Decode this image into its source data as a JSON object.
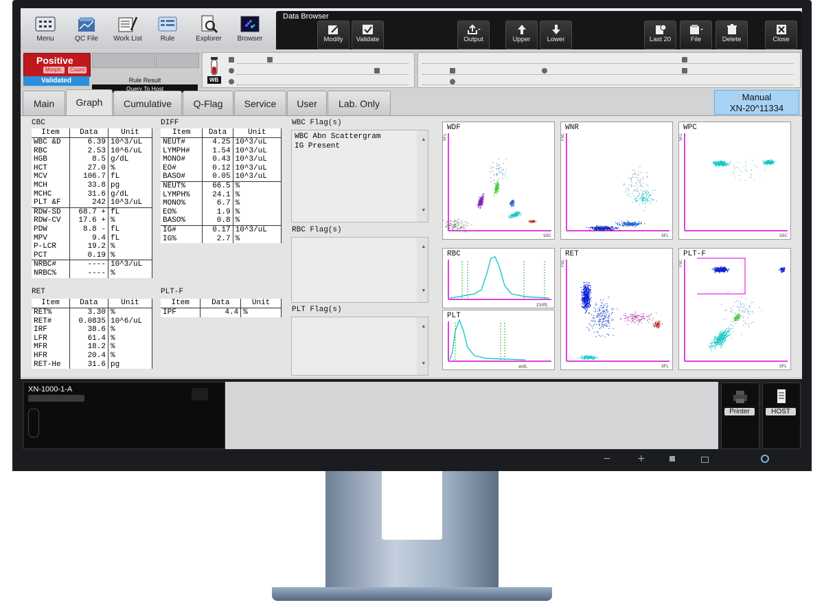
{
  "toolbar": {
    "left_buttons": [
      "Menu",
      "QC File",
      "Work List",
      "Rule",
      "Explorer",
      "Browser"
    ],
    "data_browser_title": "Data Browser",
    "db_buttons": [
      "Modify",
      "Validate",
      "Output",
      "Upper",
      "Lower",
      "Last 20",
      "File",
      "Delete",
      "Close"
    ]
  },
  "status": {
    "result": "Positive",
    "morph": "Morph.",
    "count": "Count",
    "validated": "Validated",
    "rule_result": "Rule Result",
    "query_to_host": "Query To Host",
    "tube_label": "WB"
  },
  "tabs": [
    "Main",
    "Graph",
    "Cumulative",
    "Q-Flag",
    "Service",
    "User",
    "Lab. Only"
  ],
  "active_tab": "Graph",
  "manual": {
    "line1": "Manual",
    "line2": "XN-20^11334"
  },
  "cbc": {
    "title": "CBC",
    "headers": [
      "Item",
      "Data",
      "Unit"
    ],
    "rows": [
      [
        "WBC &D",
        "6.39",
        "10^3/uL"
      ],
      [
        "RBC",
        "2.53",
        "10^6/uL"
      ],
      [
        "HGB",
        "8.5",
        "g/dL"
      ],
      [
        "HCT",
        "27.0",
        "%"
      ],
      [
        "MCV",
        "106.7",
        "fL"
      ],
      [
        "MCH",
        "33.8",
        "pg"
      ],
      [
        "MCHC",
        "31.6",
        "g/dL"
      ],
      [
        "PLT &F",
        "242",
        "10^3/uL"
      ],
      [
        "RDW-SD",
        "68.7 +",
        "fL"
      ],
      [
        "RDW-CV",
        "17.6 +",
        "%"
      ],
      [
        "PDW",
        "8.8 -",
        "fL"
      ],
      [
        "MPV",
        "9.4",
        "fL"
      ],
      [
        "P-LCR",
        "19.2",
        "%"
      ],
      [
        "PCT",
        "0.19",
        "%"
      ],
      [
        "NRBC#",
        "----",
        "10^3/uL"
      ],
      [
        "NRBC%",
        "----",
        "%"
      ]
    ]
  },
  "ret": {
    "title": "RET",
    "headers": [
      "Item",
      "Data",
      "Unit"
    ],
    "rows": [
      [
        "RET%",
        "3.30",
        "%"
      ],
      [
        "RET#",
        "0.0835",
        "10^6/uL"
      ],
      [
        "IRF",
        "38.6",
        "%"
      ],
      [
        "LFR",
        "61.4",
        "%"
      ],
      [
        "MFR",
        "18.2",
        "%"
      ],
      [
        "HFR",
        "20.4",
        "%"
      ],
      [
        "RET-He",
        "31.6",
        "pg"
      ]
    ]
  },
  "diff": {
    "title": "DIFF",
    "headers": [
      "Item",
      "Data",
      "Unit"
    ],
    "rows": [
      [
        "NEUT#",
        "4.25",
        "10^3/uL"
      ],
      [
        "LYMPH#",
        "1.54",
        "10^3/uL"
      ],
      [
        "MONO#",
        "0.43",
        "10^3/uL"
      ],
      [
        "EO#",
        "0.12",
        "10^3/uL"
      ],
      [
        "BASO#",
        "0.05",
        "10^3/uL"
      ],
      [
        "NEUT%",
        "66.5",
        "%"
      ],
      [
        "LYMPH%",
        "24.1",
        "%"
      ],
      [
        "MONO%",
        "6.7",
        "%"
      ],
      [
        "EO%",
        "1.9",
        "%"
      ],
      [
        "BASO%",
        "0.8",
        "%"
      ],
      [
        "IG#",
        "0.17",
        "10^3/uL"
      ],
      [
        "IG%",
        "2.7",
        "%"
      ]
    ]
  },
  "pltf": {
    "title": "PLT-F",
    "headers": [
      "Item",
      "Data",
      "Unit"
    ],
    "rows": [
      [
        "IPF",
        "4.4",
        "%"
      ]
    ]
  },
  "flags": {
    "wbc_title": "WBC Flag(s)",
    "wbc_lines": [
      "WBC Abn Scattergram",
      "IG Present"
    ],
    "rbc_title": "RBC Flag(s)",
    "plt_title": "PLT Flag(s)"
  },
  "plots": {
    "wdf": {
      "title": "WDF",
      "xlabel": "SSC",
      "ylabel": "SFL"
    },
    "wnr": {
      "title": "WNR",
      "xlabel": "SFL",
      "ylabel": "FSC"
    },
    "wpc": {
      "title": "WPC",
      "xlabel": "SSC",
      "ylabel": "SFL"
    },
    "rbc": {
      "title": "RBC",
      "xunit": "250fL"
    },
    "plt": {
      "title": "PLT",
      "xunit": "40fL"
    },
    "ret": {
      "title": "RET",
      "xlabel": "SFL",
      "ylabel": "FSC"
    },
    "pltf": {
      "title": "PLT-F",
      "xlabel": "SFL",
      "ylabel": "FSC"
    }
  },
  "bottom": {
    "instrument": "XN-1000-1-A",
    "printer": "Printer",
    "host": "HOST"
  },
  "colors": {
    "positive": "#c0181d",
    "validated": "#2c8fd8",
    "manual_bg": "#a9d3f4",
    "axis_magenta": "#d400d4",
    "cyan": "#19c8c8",
    "blue": "#1426d6"
  }
}
